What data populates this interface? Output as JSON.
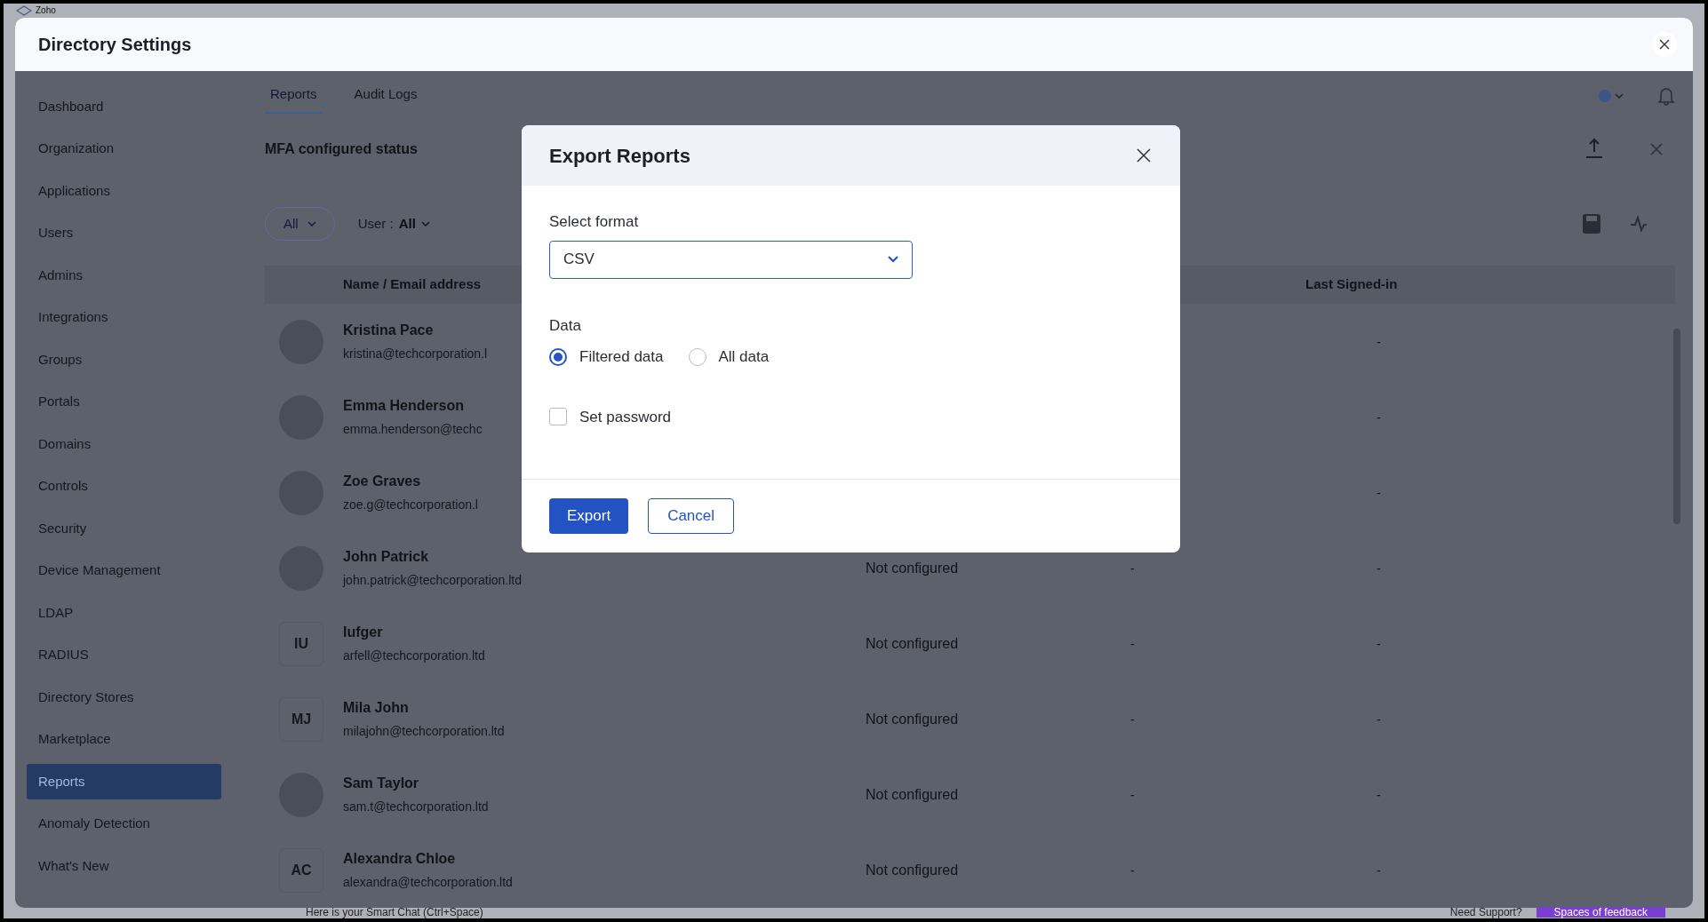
{
  "app_header": {
    "logo_text": "Zoho"
  },
  "window": {
    "title": "Directory Settings"
  },
  "sidebar": {
    "items": [
      {
        "label": "Dashboard",
        "selected": false
      },
      {
        "label": "Organization",
        "selected": false
      },
      {
        "label": "Applications",
        "selected": false
      },
      {
        "label": "Users",
        "selected": false
      },
      {
        "label": "Admins",
        "selected": false
      },
      {
        "label": "Integrations",
        "selected": false
      },
      {
        "label": "Groups",
        "selected": false
      },
      {
        "label": "Portals",
        "selected": false
      },
      {
        "label": "Domains",
        "selected": false
      },
      {
        "label": "Controls",
        "selected": false
      },
      {
        "label": "Security",
        "selected": false
      },
      {
        "label": "Device Management",
        "selected": false
      },
      {
        "label": "LDAP",
        "selected": false
      },
      {
        "label": "RADIUS",
        "selected": false
      },
      {
        "label": "Directory Stores",
        "selected": false
      },
      {
        "label": "Marketplace",
        "selected": false
      },
      {
        "label": "Reports",
        "selected": true
      },
      {
        "label": "Anomaly Detection",
        "selected": false
      },
      {
        "label": "What's New",
        "selected": false
      }
    ]
  },
  "tabs": [
    {
      "label": "Reports",
      "selected": true
    },
    {
      "label": "Audit Logs",
      "selected": false
    }
  ],
  "report": {
    "title": "MFA configured status",
    "filters": [
      {
        "kind": "chip",
        "label": "All"
      },
      {
        "kind": "dropdown",
        "label": "User :",
        "value": "All"
      }
    ]
  },
  "table": {
    "columns": [
      "Name / Email address",
      "Last Signed-in"
    ],
    "rows": [
      {
        "kind": "photo",
        "name": "Kristina Pace",
        "email": "kristina@techcorporation.l",
        "last_signed_in": "-"
      },
      {
        "kind": "photo",
        "name": "Emma Henderson",
        "email": "emma.henderson@techc",
        "last_signed_in": "-"
      },
      {
        "kind": "photo",
        "name": "Zoe Graves",
        "email": "zoe.g@techcorporation.l",
        "last_signed_in": "-"
      },
      {
        "kind": "photo",
        "name": "John Patrick",
        "email": "john.patrick@techcorporation.ltd",
        "status": "Not configured",
        "column_3": "-",
        "last_signed_in": "-"
      },
      {
        "kind": "initials",
        "initials": "IU",
        "name": "Iufger",
        "email": "arfell@techcorporation.ltd",
        "status": "Not configured",
        "column_3": "-",
        "last_signed_in": "-"
      },
      {
        "kind": "initials",
        "initials": "MJ",
        "name": "Mila John",
        "email": "milajohn@techcorporation.ltd",
        "status": "Not configured",
        "column_3": "-",
        "last_signed_in": "-"
      },
      {
        "kind": "photo",
        "name": "Sam Taylor",
        "email": "sam.t@techcorporation.ltd",
        "status": "Not configured",
        "column_3": "-",
        "last_signed_in": "-"
      },
      {
        "kind": "initials",
        "initials": "AC",
        "name": "Alexandra Chloe",
        "email": "alexandra@techcorporation.ltd",
        "status": "Not configured",
        "column_3": "-",
        "last_signed_in": "-"
      }
    ]
  },
  "dialog": {
    "title": "Export Reports",
    "format_label": "Select format",
    "format_value": "CSV",
    "data_label": "Data",
    "data_options": [
      {
        "label": "Filtered data",
        "selected": true
      },
      {
        "label": "All data",
        "selected": false
      }
    ],
    "set_password": {
      "label": "Set password",
      "checked": false
    },
    "buttons": [
      {
        "kind": "primary",
        "label": "Export"
      },
      {
        "kind": "secondary",
        "label": "Cancel"
      }
    ]
  },
  "bottom_bar": {
    "chat_hint": "Here is your Smart Chat (Ctrl+Space)",
    "support": "Need Support?",
    "feedback": "Spaces of feedback"
  }
}
